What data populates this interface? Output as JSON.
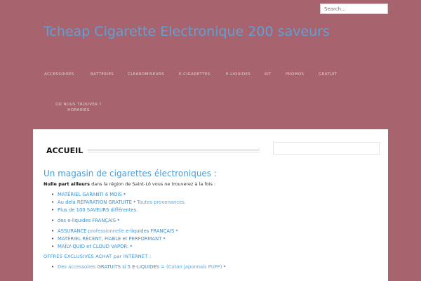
{
  "search": {
    "placeholder": "Search..."
  },
  "site": {
    "title": "Tcheap Cigarette Electronique 200 saveurs",
    "tagline": ""
  },
  "nav": {
    "items": [
      "ACCESSOIRES",
      "BATTERIES",
      "CLEAROMISEURS",
      "E-CIGARETTES",
      "E-LIQUIDES",
      "KIT",
      "PROMOS",
      "GRATUIT",
      "OÙ NOUS TROUVER ? HORAIRES"
    ]
  },
  "page": {
    "title": "ACCUEIL"
  },
  "content": {
    "heading": "Un magasin de cigarettes électroniques :",
    "intro_bold": "Nulle part ailleurs",
    "intro_rest": " dans la région de Saint-Lô vous ne trouverez à la fois :",
    "features": [
      {
        "main": "MATÉRIEL GARANTI  6 MOIS",
        "extra": ""
      },
      {
        "main": "Au delà RÉPARATION GRATUITE",
        "extra": " Toutes provenances."
      },
      {
        "main": "Plus de 100 SAVEURS différentes.",
        "extra": ""
      },
      {
        "main": "des e-liquides FRANÇAIS",
        "extra": ""
      },
      {
        "pre": "ASSURANCE ",
        "pre2": "professionnelle",
        "main": " e-liquides FRANÇAIS",
        "extra": ""
      },
      {
        "main": "MATÉRIEL RÉCENT, FIABLE et PERFORMANT",
        "extra": ""
      },
      {
        "main": "MAÏLY-QUID et CLOUD VAPOR.",
        "extra": ""
      }
    ],
    "offers_heading": "OFFRES   EXCLUSIVES   ACHAT   par   INTERNET :",
    "offer": {
      "part1": "Des accessoires ",
      "part2": "GRATUITS",
      "part3": " si 5 E-LIQUIDES = ",
      "part4": "(Coton japonnais PUFF)"
    },
    "star": "*"
  },
  "colors": {
    "background": "#a8646e",
    "link": "#3b8fd0",
    "title": "#5fa0d6",
    "panel": "#ffffff"
  }
}
